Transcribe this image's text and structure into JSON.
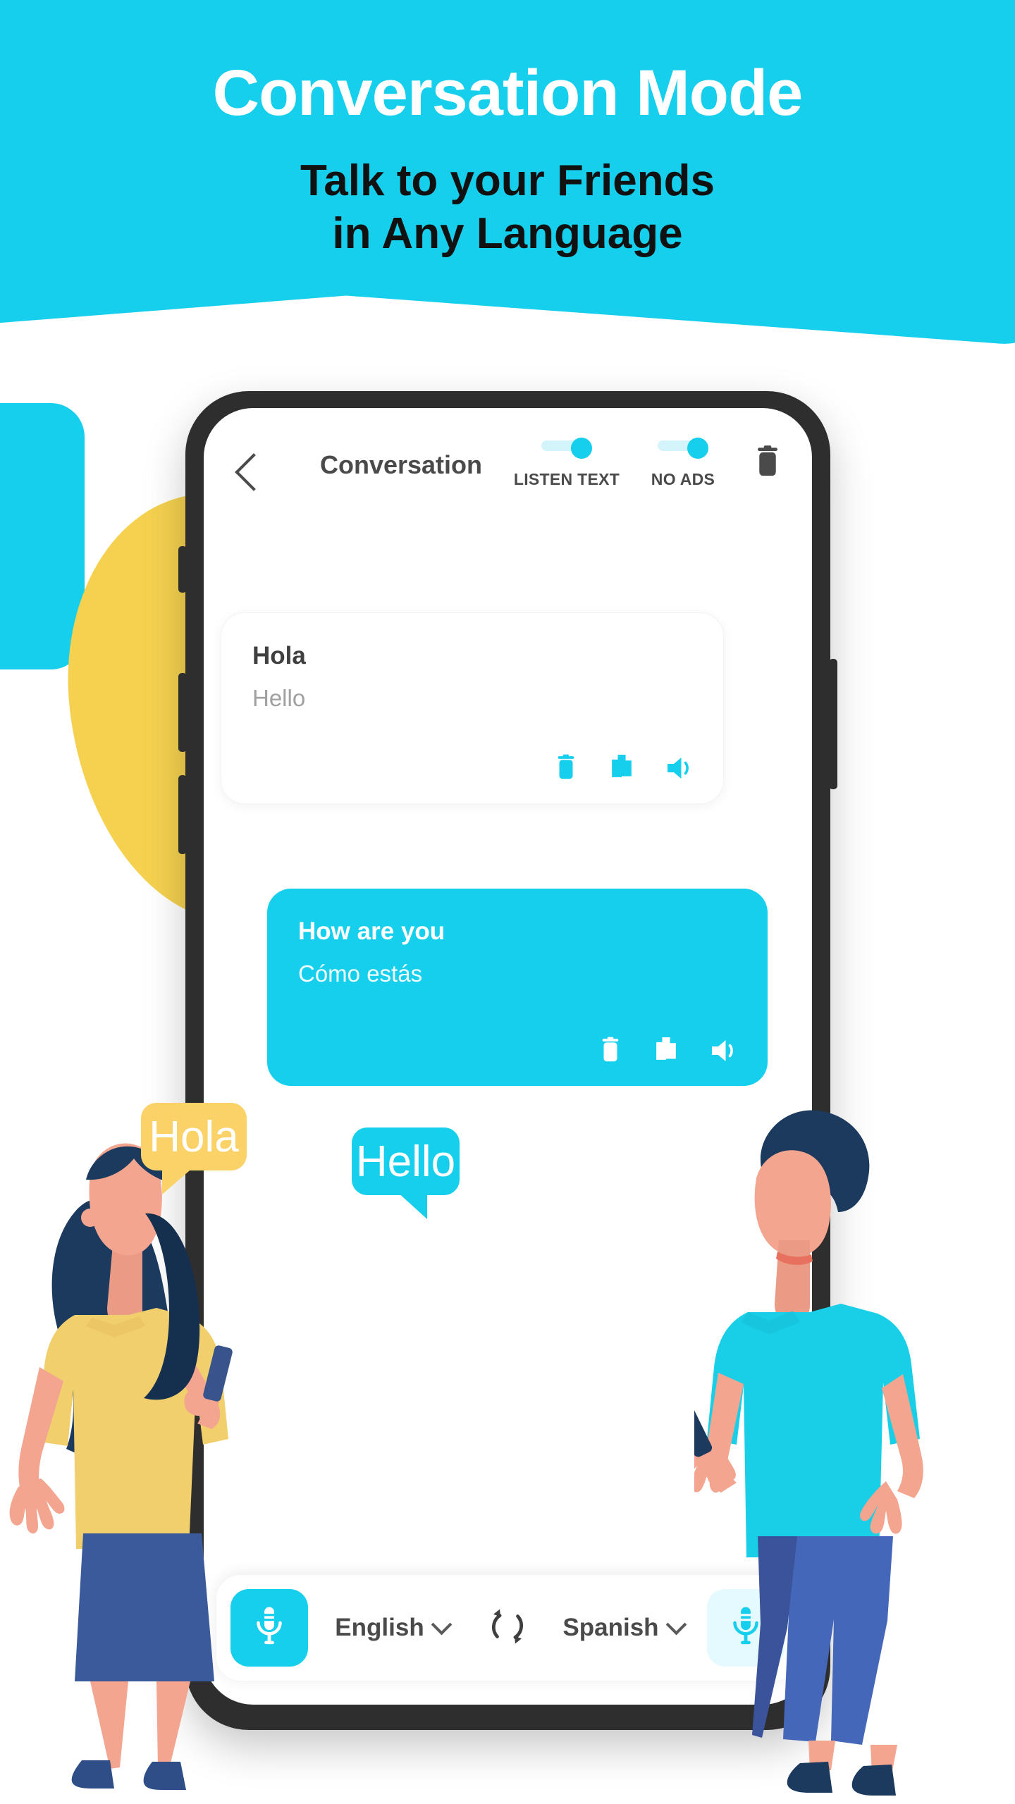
{
  "promo": {
    "title": "Conversation Mode",
    "subtitle_line1": "Talk to your Friends",
    "subtitle_line2": "in Any Language"
  },
  "colors": {
    "cyan": "#15cfec",
    "yellow": "#fbd268",
    "navy": "#1c3a5e",
    "title_text": "#ffffff",
    "subtitle_text": "#111111",
    "header_text": "#4a4a4a"
  },
  "app": {
    "header": {
      "back_icon": "chevron-left-icon",
      "title": "Conversation",
      "delete_icon": "trash-icon",
      "toggles": [
        {
          "label": "LISTEN TEXT",
          "state": "on"
        },
        {
          "label": "NO ADS",
          "state": "on"
        }
      ]
    },
    "messages": [
      {
        "primary": "Hola",
        "secondary": "Hello",
        "style": "white",
        "actions": [
          "trash-icon",
          "copy-icon",
          "speaker-icon"
        ]
      },
      {
        "primary": "How are you",
        "secondary": "Cómo estás",
        "style": "cyan",
        "actions": [
          "trash-icon",
          "copy-icon",
          "speaker-icon"
        ]
      }
    ],
    "bottom_bar": {
      "mic_left_icon": "microphone-icon",
      "source_language": "English",
      "swap_icon": "swap-languages-icon",
      "target_language": "Spanish",
      "mic_right_icon": "microphone-icon"
    }
  },
  "illustration": {
    "speech_bubble_left": "Hola",
    "speech_bubble_right": "Hello"
  }
}
